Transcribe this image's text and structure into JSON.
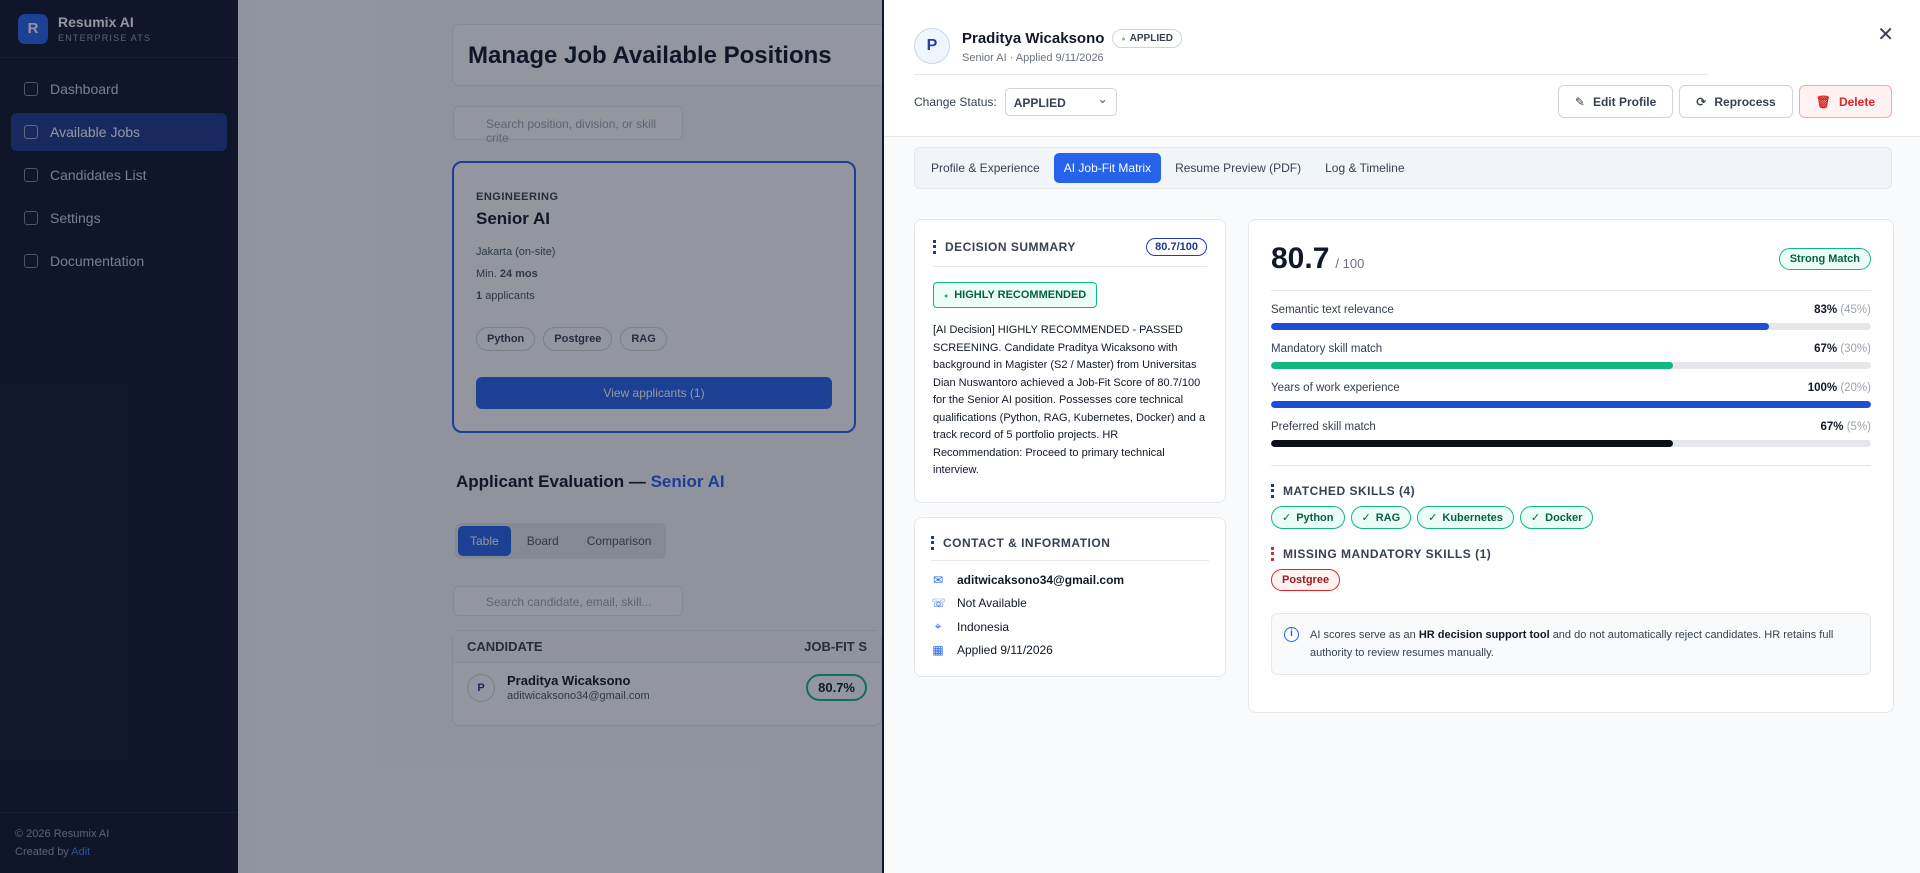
{
  "brand": {
    "logo_letter": "R",
    "name": "Resumix AI",
    "subtitle": "ENTERPRISE ATS"
  },
  "nav": [
    {
      "label": "Dashboard",
      "icon": "grid-icon",
      "active": false
    },
    {
      "label": "Available Jobs",
      "icon": "briefcase-icon",
      "active": true
    },
    {
      "label": "Candidates List",
      "icon": "users-icon",
      "active": false
    },
    {
      "label": "Settings",
      "icon": "sliders-icon",
      "active": false
    },
    {
      "label": "Documentation",
      "icon": "book-icon",
      "active": false
    }
  ],
  "footer": {
    "copyright": "© 2026 Resumix AI",
    "created_by": "Created by",
    "author": "Adit"
  },
  "page": {
    "title": "Manage Job Available Positions",
    "search_placeholder": "Search position, division, or skill crite",
    "job": {
      "division": "ENGINEERING",
      "title": "Senior AI",
      "location": "Jakarta (on-site)",
      "min_label": "Min.",
      "min_value": "24 mos",
      "applicants_count": "1",
      "applicants_label": "applicants",
      "skills": [
        "Python",
        "Postgree",
        "RAG"
      ],
      "view_button": "View applicants (1)"
    },
    "eval_title_prefix": "Applicant Evaluation —",
    "eval_title_job": "Senior AI",
    "view_tabs": [
      "Table",
      "Board",
      "Comparison"
    ],
    "candidate_search_placeholder": "Search candidate, email, skill...",
    "table": {
      "col_candidate": "CANDIDATE",
      "col_fit": "JOB-FIT S",
      "row": {
        "initial": "P",
        "name": "Praditya Wicaksono",
        "email": "aditwicaksono34@gmail.com",
        "score": "80.7%"
      }
    }
  },
  "drawer": {
    "initial": "P",
    "name": "Praditya Wicaksono",
    "status_badge": "APPLIED",
    "subtitle": "Senior AI · Applied 9/11/2026",
    "change_status_label": "Change Status:",
    "status_value": "APPLIED",
    "actions": {
      "edit": "Edit Profile",
      "reprocess": "Reprocess",
      "delete": "Delete"
    },
    "tabs": [
      "Profile & Experience",
      "AI Job-Fit Matrix",
      "Resume Preview (PDF)",
      "Log & Timeline"
    ],
    "active_tab": 1,
    "decision": {
      "title": "DECISION SUMMARY",
      "score": "80.7/100",
      "badge": "HIGHLY RECOMMENDED",
      "text": "[AI Decision] HIGHLY RECOMMENDED - PASSED SCREENING. Candidate Praditya Wicaksono with background in Magister (S2 / Master) from Universitas Dian Nuswantoro achieved a Job-Fit Score of 80.7/100 for the Senior AI position. Possesses core technical qualifications (Python, RAG, Kubernetes, Docker) and a track record of 5 portfolio projects. HR Recommendation: Proceed to primary technical interview."
    },
    "contact": {
      "title": "CONTACT & INFORMATION",
      "email": "aditwicaksono34@gmail.com",
      "phone": "Not Available",
      "location": "Indonesia",
      "applied": "Applied 9/11/2026"
    },
    "fit": {
      "score": "80.7",
      "out_of": "/ 100",
      "match_badge": "Strong Match",
      "criteria": [
        {
          "label": "Semantic text relevance",
          "value": "83%",
          "weight": "(45%)",
          "pct": 83,
          "color": "#1d4ed8"
        },
        {
          "label": "Mandatory skill match",
          "value": "67%",
          "weight": "(30%)",
          "pct": 67,
          "color": "#10b981"
        },
        {
          "label": "Years of work experience",
          "value": "100%",
          "weight": "(20%)",
          "pct": 100,
          "color": "#1d4ed8"
        },
        {
          "label": "Preferred skill match",
          "value": "67%",
          "weight": "(5%)",
          "pct": 67,
          "color": "#0b0f19"
        }
      ],
      "matched_title": "MATCHED SKILLS (4)",
      "matched": [
        "Python",
        "RAG",
        "Kubernetes",
        "Docker"
      ],
      "missing_title": "MISSING MANDATORY SKILLS (1)",
      "missing": [
        "Postgree"
      ],
      "note_prefix": "AI scores serve as an",
      "note_bold": "HR decision support tool",
      "note_suffix": "and do not automatically reject candidates. HR retains full authority to review resumes manually."
    }
  }
}
